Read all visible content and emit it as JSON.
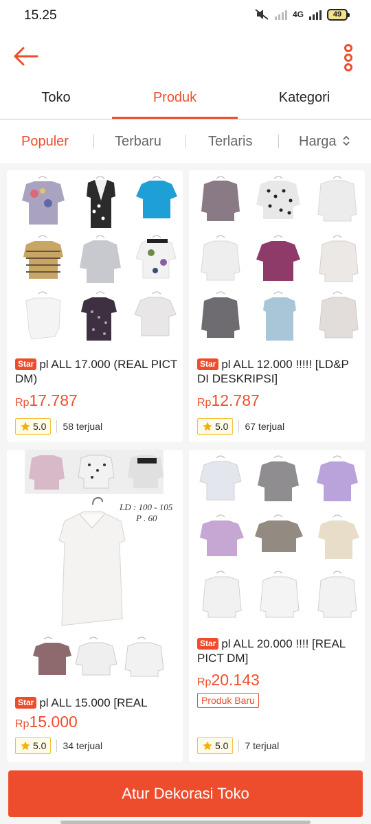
{
  "status_bar": {
    "time": "15.25",
    "network": "4G",
    "battery": "49"
  },
  "app_bar": {
    "back_icon": "back-arrow-icon",
    "menu_icon": "more-vertical-icon"
  },
  "tabs": [
    {
      "label": "Toko",
      "active": false
    },
    {
      "label": "Produk",
      "active": true
    },
    {
      "label": "Kategori",
      "active": false
    }
  ],
  "sort": {
    "populer": "Populer",
    "terbaru": "Terbaru",
    "terlaris": "Terlaris",
    "harga": "Harga",
    "harga_icon": "sort-updown-icon"
  },
  "products": [
    {
      "badge": "Star",
      "title": "pl ALL 17.000 (REAL PICT DM)",
      "currency": "Rp",
      "price": "17.787",
      "rating": "5.0",
      "sold": "58 terjual"
    },
    {
      "badge": "Star",
      "title": "pl ALL 12.000 !!!!! [LD&P DI DESKRIPSI]",
      "currency": "Rp",
      "price": "12.787",
      "rating": "5.0",
      "sold": "67 terjual"
    },
    {
      "badge": "Star",
      "title": "pl ALL 15.000 [REAL",
      "currency": "Rp",
      "price": "15.000",
      "rating": "5.0",
      "sold": "34 terjual",
      "image_label_1": "LD : 100 - 105",
      "image_label_2": "P . 60"
    },
    {
      "badge": "Star",
      "title": "pl ALL 20.000 !!!! [REAL PICT DM]",
      "currency": "Rp",
      "price": "20.143",
      "tag": "Produk Baru",
      "rating": "5.0",
      "sold": "7 terjual"
    }
  ],
  "cta": {
    "label": "Atur Dekorasi Toko"
  },
  "colors": {
    "accent": "#ee4d2d",
    "rating_border": "#f0c33c"
  }
}
